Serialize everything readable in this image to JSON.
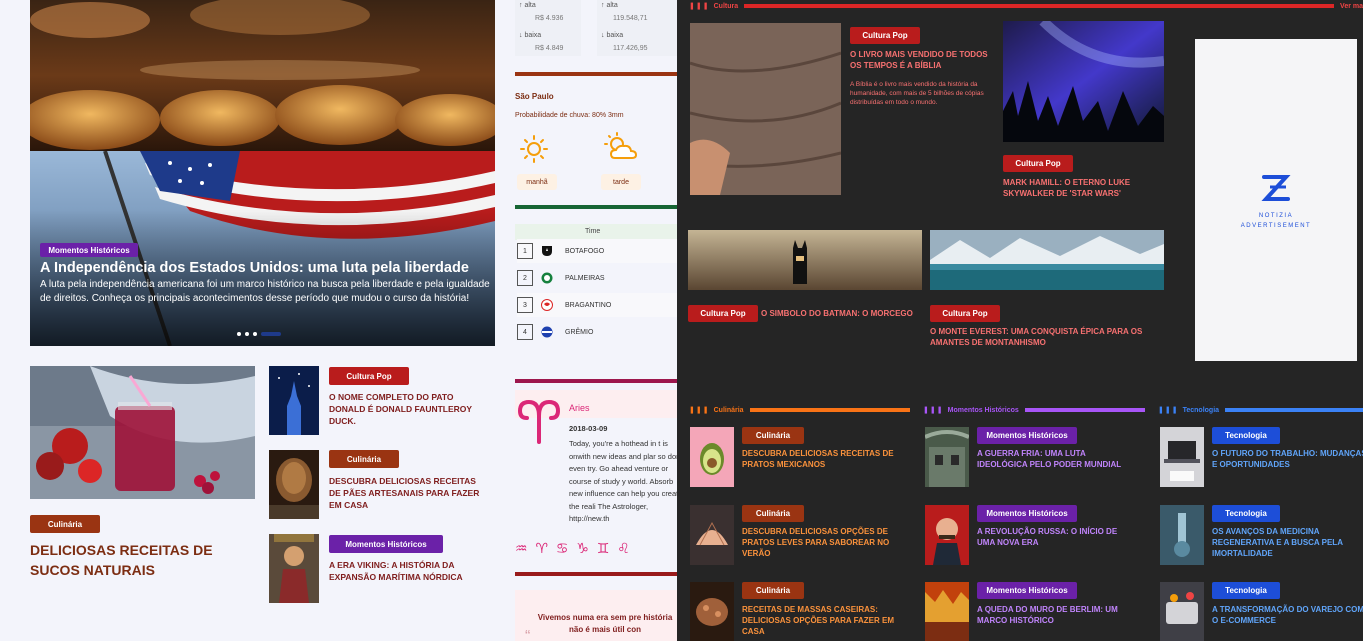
{
  "left": {
    "hero": {
      "category": "Momentos Históricos",
      "title": "A Independência dos Estados Unidos: uma luta pela liberdade",
      "description": "A luta pela independência americana foi um marco histórico na busca pela liberdade e pela igualdade de direitos. Conheça os principais acontecimentos desse período que mudou o curso da história!"
    },
    "feature": {
      "category": "Culinária",
      "title": "DELICIOSAS RECEITAS DE SUCOS NATURAIS"
    },
    "list": [
      {
        "category": "Cultura Pop",
        "title": "O NOME COMPLETO DO PATO DONALD É DONALD FAUNTLEROY DUCK."
      },
      {
        "category": "Culinária",
        "title": "DESCUBRA DELICIOSAS RECEITAS DE PÃES ARTESANAIS PARA FAZER EM CASA"
      },
      {
        "category": "Momentos Históricos",
        "title": "A ERA VIKING: A HISTÓRIA DA EXPANSÃO MARÍTIMA NÓRDICA"
      }
    ]
  },
  "market": {
    "col1": {
      "up_label": "alta",
      "up_value": "R$ 4.936",
      "down_label": "baixa",
      "down_value": "R$ 4.849"
    },
    "col2": {
      "up_label": "alta",
      "up_value": "119.548,71",
      "down_label": "baixa",
      "down_value": "117.426,95"
    }
  },
  "weather": {
    "city": "São Paulo",
    "rain": "Probabilidade de chuva: 80% 3mm",
    "periods": [
      {
        "label": "manhã",
        "icon": "sun-icon"
      },
      {
        "label": "tarde",
        "icon": "cloud-sun-icon"
      }
    ]
  },
  "table": {
    "header": "Time",
    "rows": [
      {
        "pos": "1",
        "team": "BOTAFOGO"
      },
      {
        "pos": "2",
        "team": "PALMEIRAS"
      },
      {
        "pos": "3",
        "team": "BRAGANTINO"
      },
      {
        "pos": "4",
        "team": "GRÊMIO"
      }
    ]
  },
  "horoscope": {
    "sign": "Aries",
    "date": "2018-03-09",
    "text": "Today, you're a hothead in t is onwith new ideas and plar so don't even try. Go ahead venture or course of study y world. Absorb new influence can help you create the reali The Astrologer, http://new.th",
    "symbols": "♒ ♈ ♋ ♑ ♊ ♌"
  },
  "quote": {
    "text": "Vivemos numa era sem pre história não é mais útil con"
  },
  "dark": {
    "cultura": {
      "header": "Cultura",
      "more": "Ver ma",
      "items": [
        {
          "category": "Cultura Pop",
          "title": "O LIVRO MAIS VENDIDO DE TODOS OS TEMPOS É A BÍBLIA",
          "desc": "A Bíblia é o livro mais vendido da história da humanidade, com mais de 5 bilhões de cópias distribuídas em todo o mundo."
        },
        {
          "category": "Cultura Pop",
          "title": "MARK HAMILL: O ETERNO LUKE SKYWALKER DE 'STAR WARS'"
        },
        {
          "category": "Cultura Pop",
          "title": "O SIMBOLO DO BATMAN: O MORCEGO"
        },
        {
          "category": "Cultura Pop",
          "title": "O MONTE EVEREST: UMA CONQUISTA ÉPICA PARA OS AMANTES DE MONTANHISMO"
        }
      ]
    },
    "ad": {
      "brand": "NOTIZIA",
      "label": "ADVERTISEMENT"
    },
    "culinaria": {
      "header": "Culinária",
      "items": [
        {
          "category": "Culinária",
          "title": "DESCUBRA DELICIOSAS RECEITAS DE PRATOS MEXICANOS"
        },
        {
          "category": "Culinária",
          "title": "DESCUBRA DELICIOSAS OPÇÕES DE PRATOS LEVES PARA SABOREAR NO VERÃO"
        },
        {
          "category": "Culinária",
          "title": "RECEITAS DE MASSAS CASEIRAS: DELICIOSAS OPÇÕES PARA FAZER EM CASA"
        }
      ]
    },
    "momentos": {
      "header": "Momentos Históricos",
      "items": [
        {
          "category": "Momentos Históricos",
          "title": "A GUERRA FRIA: UMA LUTA IDEOLÓGICA PELO PODER MUNDIAL"
        },
        {
          "category": "Momentos Históricos",
          "title": "A REVOLUÇÃO RUSSA: O INÍCIO DE UMA NOVA ERA"
        },
        {
          "category": "Momentos Históricos",
          "title": "A QUEDA DO MURO DE BERLIM: UM MARCO HISTÓRICO"
        }
      ]
    },
    "tecnologia": {
      "header": "Tecnologia",
      "items": [
        {
          "category": "Tecnologia",
          "title": "O FUTURO DO TRABALHO: MUDANÇAS E OPORTUNIDADES"
        },
        {
          "category": "Tecnologia",
          "title": "OS AVANÇOS DA MEDICINA REGENERATIVA E A BUSCA PELA IMORTALIDADE"
        },
        {
          "category": "Tecnologia",
          "title": "A TRANSFORMAÇÃO DO VAREJO COM O E-COMMERCE"
        }
      ]
    }
  }
}
